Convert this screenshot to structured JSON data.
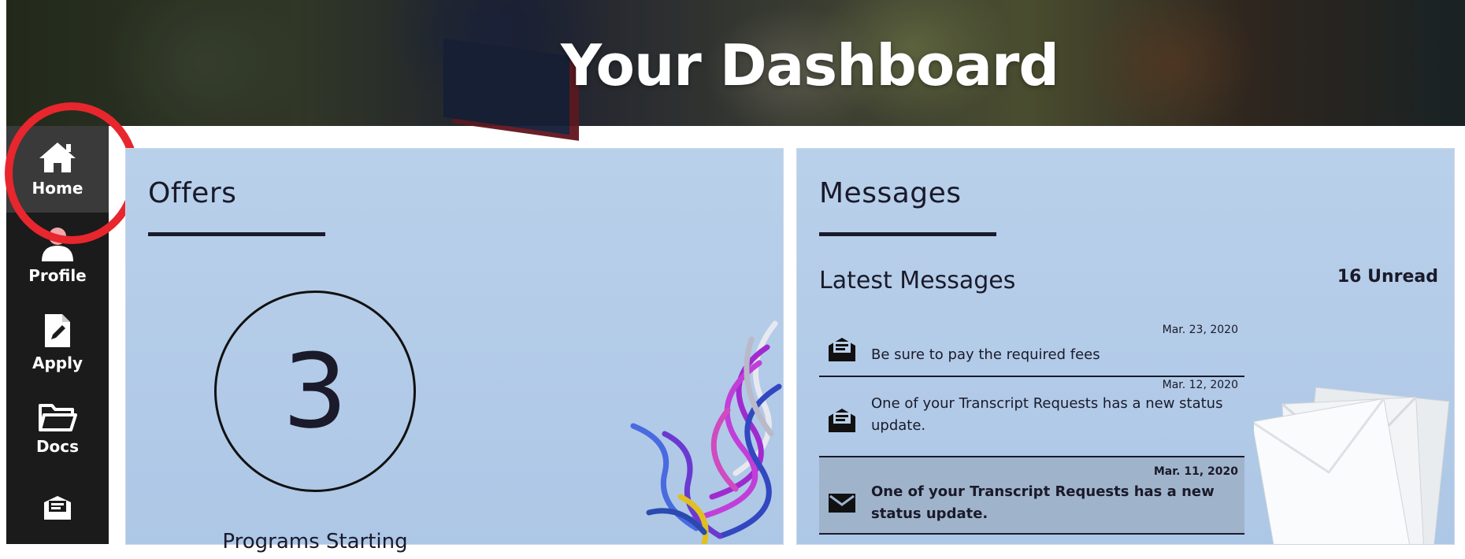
{
  "header": {
    "title": "Your Dashboard"
  },
  "sidebar": {
    "items": [
      {
        "label": "Home",
        "icon": "home-icon",
        "active": true
      },
      {
        "label": "Profile",
        "icon": "user-icon"
      },
      {
        "label": "Apply",
        "icon": "document-edit-icon"
      },
      {
        "label": "Docs",
        "icon": "folder-icon"
      },
      {
        "label": "",
        "icon": "message-icon"
      }
    ]
  },
  "offers": {
    "title": "Offers",
    "count": "3",
    "caption": "Programs Starting"
  },
  "messages": {
    "title": "Messages",
    "latest_title": "Latest Messages",
    "unread": "16 Unread",
    "items": [
      {
        "date": "Mar. 23, 2020",
        "text": "Be sure to pay the required fees",
        "status": "read"
      },
      {
        "date": "Mar. 12, 2020",
        "text": "One of your Transcript Requests has a new status update.",
        "status": "read"
      },
      {
        "date": "Mar. 11, 2020",
        "text": "One of your Transcript Requests has a new status update.",
        "status": "unread"
      }
    ]
  },
  "colors": {
    "card_background": "#b9d0ea",
    "sidebar_background": "#1b1b1b",
    "highlight_ring": "#e8262d"
  }
}
